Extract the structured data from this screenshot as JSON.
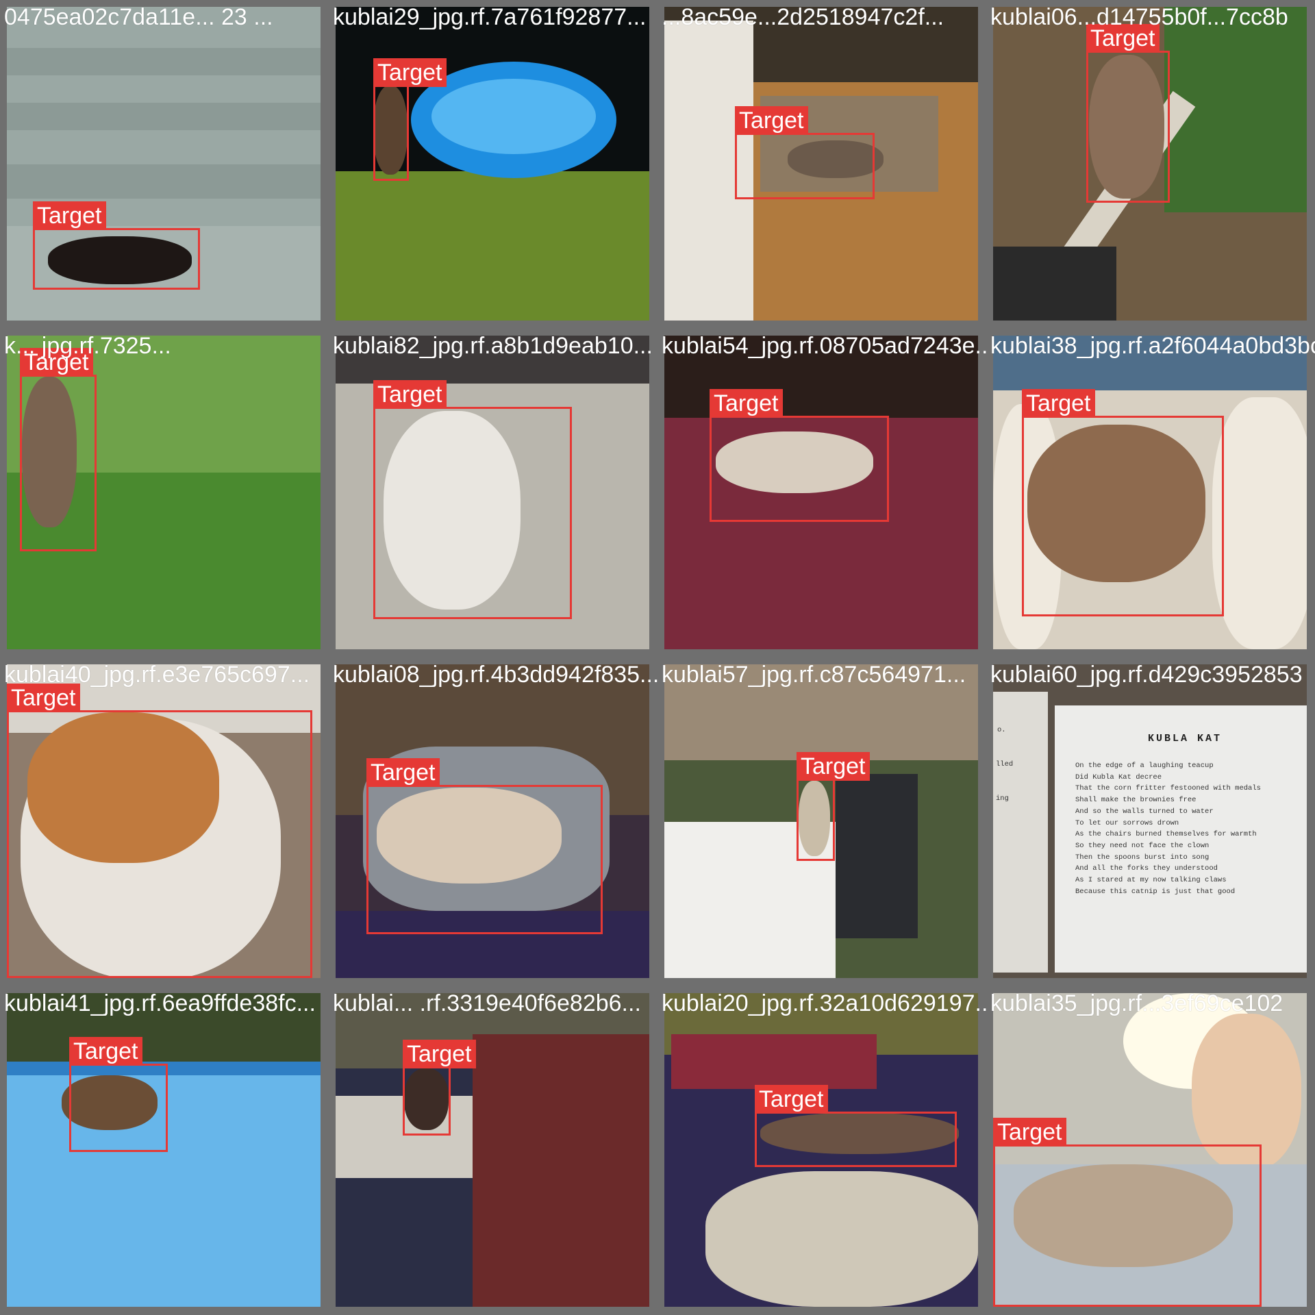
{
  "box_label": "Target",
  "box_color": "#e53935",
  "tiles": [
    {
      "caption": "0475ea02c7da11e... 23 ...",
      "scene": "cat lying on concrete steps",
      "colors": {
        "bg": "#9aa8a4",
        "mid": "#7f8e8a",
        "cat": "#1e1715"
      }
    },
    {
      "caption": "kublai29_jpg.rf.7a761f92877...",
      "scene": "cat near inflatable pool on grass",
      "colors": {
        "bg": "#0b0f10",
        "mid": "#6a8a2b",
        "accent": "#1e8ee0",
        "cat": "#5a4330"
      }
    },
    {
      "caption": "...8ac59e...2d2518947c2f...",
      "scene": "cat on wooden floor by door",
      "colors": {
        "bg": "#b07a3e",
        "mid": "#e8e4dc",
        "cat": "#6b5a4b"
      }
    },
    {
      "caption": "kublai06...d14755b0f...7cc8b",
      "scene": "cat on porch rail",
      "colors": {
        "bg": "#6f5c44",
        "mid": "#d9d3c6",
        "cat": "#8a6e58"
      }
    },
    {
      "caption": "k... jpg.rf.7325...",
      "scene": "cat standing in garden grass",
      "colors": {
        "bg": "#4f8a36",
        "mid": "#9fc062",
        "cat": "#7a6350"
      }
    },
    {
      "caption": "kublai82_jpg.rf.a8b1d9eab10...",
      "scene": "cat lying on tile floor",
      "colors": {
        "bg": "#b9b6ad",
        "mid": "#d6d3cb",
        "cat": "#e9e6e0"
      }
    },
    {
      "caption": "kublai54_jpg.rf.08705ad7243e...",
      "scene": "cat sleeping on dark red futon",
      "colors": {
        "bg": "#3a1824",
        "mid": "#7a2a3c",
        "cat": "#d8cdbf"
      }
    },
    {
      "caption": "kublai38_jpg.rf.a2f6044a0bd3bc",
      "scene": "cat curled among pillows",
      "colors": {
        "bg": "#d8d0c2",
        "mid": "#efe9de",
        "cat": "#8e6a4e"
      }
    },
    {
      "caption": "kublai40_jpg.rf.e3e765c697...",
      "scene": "close-up calico cat",
      "colors": {
        "bg": "#8e7c6c",
        "mid": "#e8e3dc",
        "cat": "#c07a3e"
      }
    },
    {
      "caption": "kublai08_jpg.rf.4b3dd942f835...",
      "scene": "woman holding cat",
      "colors": {
        "bg": "#3a2d3c",
        "mid": "#8a8f96",
        "cat": "#d9c9b6"
      }
    },
    {
      "caption": "kublai57_jpg.rf.c87c564971...",
      "scene": "small cat by lattice and grill",
      "colors": {
        "bg": "#4c5a3a",
        "mid": "#f0efec",
        "cat": "#c9bda8"
      }
    },
    {
      "caption": "kublai60_jpg.rf.d429c3952853",
      "scene": "book page with poem",
      "colors": {
        "bg": "#5a5148",
        "mid": "#ececea"
      }
    },
    {
      "caption": "kublai41_jpg.rf.6ea9ffde38fc...",
      "scene": "cat peeking over blue pool edge",
      "colors": {
        "bg": "#2f7fc5",
        "mid": "#67b6ea",
        "cat": "#6b4e36"
      }
    },
    {
      "caption": "kublai... .rf.3319e40f6e82b6...",
      "scene": "cat on bed with blankets",
      "colors": {
        "bg": "#2b2e45",
        "mid": "#6b2a2a",
        "cat": "#3d2c26"
      }
    },
    {
      "caption": "kublai20_jpg.rf.32a10d629197...",
      "scene": "cat lying on purple blanket",
      "colors": {
        "bg": "#2f2952",
        "mid": "#cfc8b8",
        "cat": "#6a5244"
      }
    },
    {
      "caption": "kublai35_jpg.rf...3ef69ce102",
      "scene": "smiling woman holding cat",
      "colors": {
        "bg": "#c5c3b9",
        "mid": "#eeeeea",
        "cat": "#b8a48e"
      }
    }
  ],
  "poem": {
    "title": "KUBLA  KAT",
    "side_fragments": [
      "o.",
      "lled",
      "ing"
    ],
    "lines": [
      "On the edge of a laughing teacup",
      "Did Kubla Kat decree",
      "That the corn fritter festooned with medals",
      "Shall make the brownies free",
      "And so the walls turned to water",
      "To let our sorrows drown",
      "As the chairs burned themselves for warmth",
      "So they need not face the clown",
      "Then the spoons burst into song",
      "And all the forks they understood",
      "As I stared at my now talking claws",
      "Because this catnip is just that good"
    ]
  }
}
